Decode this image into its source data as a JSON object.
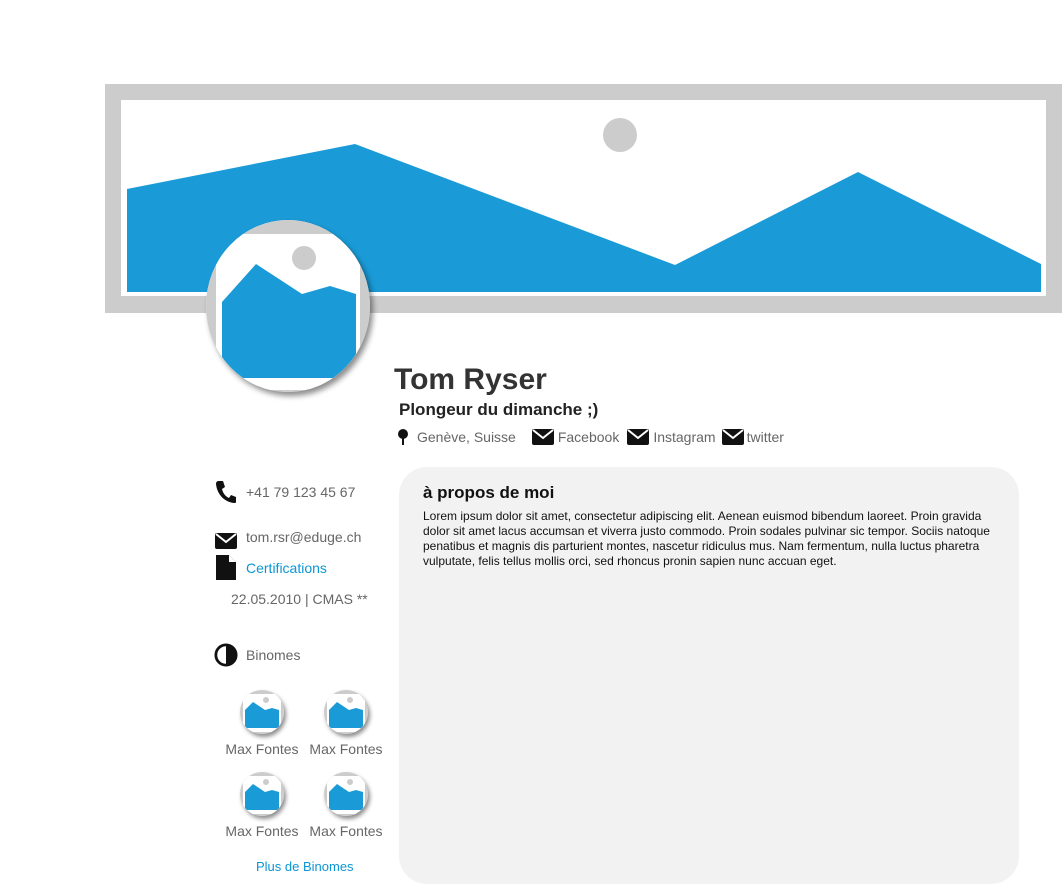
{
  "profile": {
    "name": "Tom Ryser",
    "tagline": "Plongeur du dimanche ;)",
    "location": "Genève, Suisse",
    "social": {
      "facebook": "Facebook",
      "instagram": "Instagram",
      "twitter": "twitter"
    }
  },
  "sidebar": {
    "phone": "+41 79 123 45 67",
    "email": "tom.rsr@eduge.ch",
    "certifications_label": "Certifications",
    "certification_entry": "22.05.2010 | CMAS **",
    "binomes_label": "Binomes",
    "binomes": [
      {
        "name": "Max Fontes"
      },
      {
        "name": "Max Fontes"
      },
      {
        "name": "Max Fontes"
      },
      {
        "name": "Max Fontes"
      }
    ],
    "more_binomes": "Plus de Binomes"
  },
  "about": {
    "title": "à propos de moi",
    "text": "Lorem ipsum dolor sit amet, consectetur adipiscing elit. Aenean euismod bibendum laoreet. Proin gravida dolor sit amet lacus accumsan et viverra justo commodo. Proin sodales pulvinar sic tempor. Sociis natoque penatibus et magnis dis parturient montes, nascetur ridiculus mus. Nam fermentum, nulla luctus pharetra vulputate, felis tellus mollis orci, sed rhoncus pronin sapien nunc accuan eget."
  },
  "colors": {
    "accent": "#1a9bd7",
    "placeholder_frame": "#cccccc",
    "card_bg": "#f2f2f2",
    "link": "#0b96d4"
  },
  "icons": {
    "cover": "image-placeholder-icon",
    "avatar": "image-placeholder-icon",
    "location": "map-pin-icon",
    "social": "envelope-icon",
    "phone": "phone-icon",
    "email": "envelope-icon",
    "certifications": "document-icon",
    "binomes": "half-circle-icon"
  }
}
